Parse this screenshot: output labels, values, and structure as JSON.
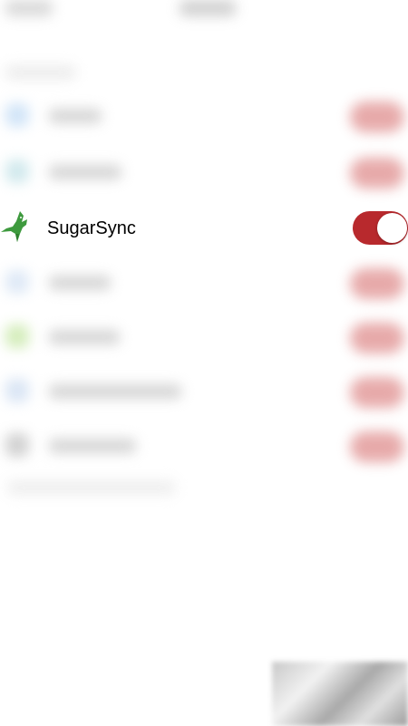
{
  "focused_app": {
    "label": "SugarSync",
    "icon": "hummingbird-icon",
    "toggle_on": true,
    "toggle_color": "#b8292d",
    "icon_color": "#3e9a3e"
  },
  "blurred_rows": [
    {
      "icon_color": "#cfe3f7"
    },
    {
      "icon_color": "#cfe8ec"
    },
    {
      "icon_color": "#dde8f6"
    },
    {
      "icon_color": "#d2ecb8"
    },
    {
      "icon_color": "#d8e4f4"
    },
    {
      "icon_color": "#cfcfcf"
    }
  ],
  "accent_color": "#b8292d"
}
